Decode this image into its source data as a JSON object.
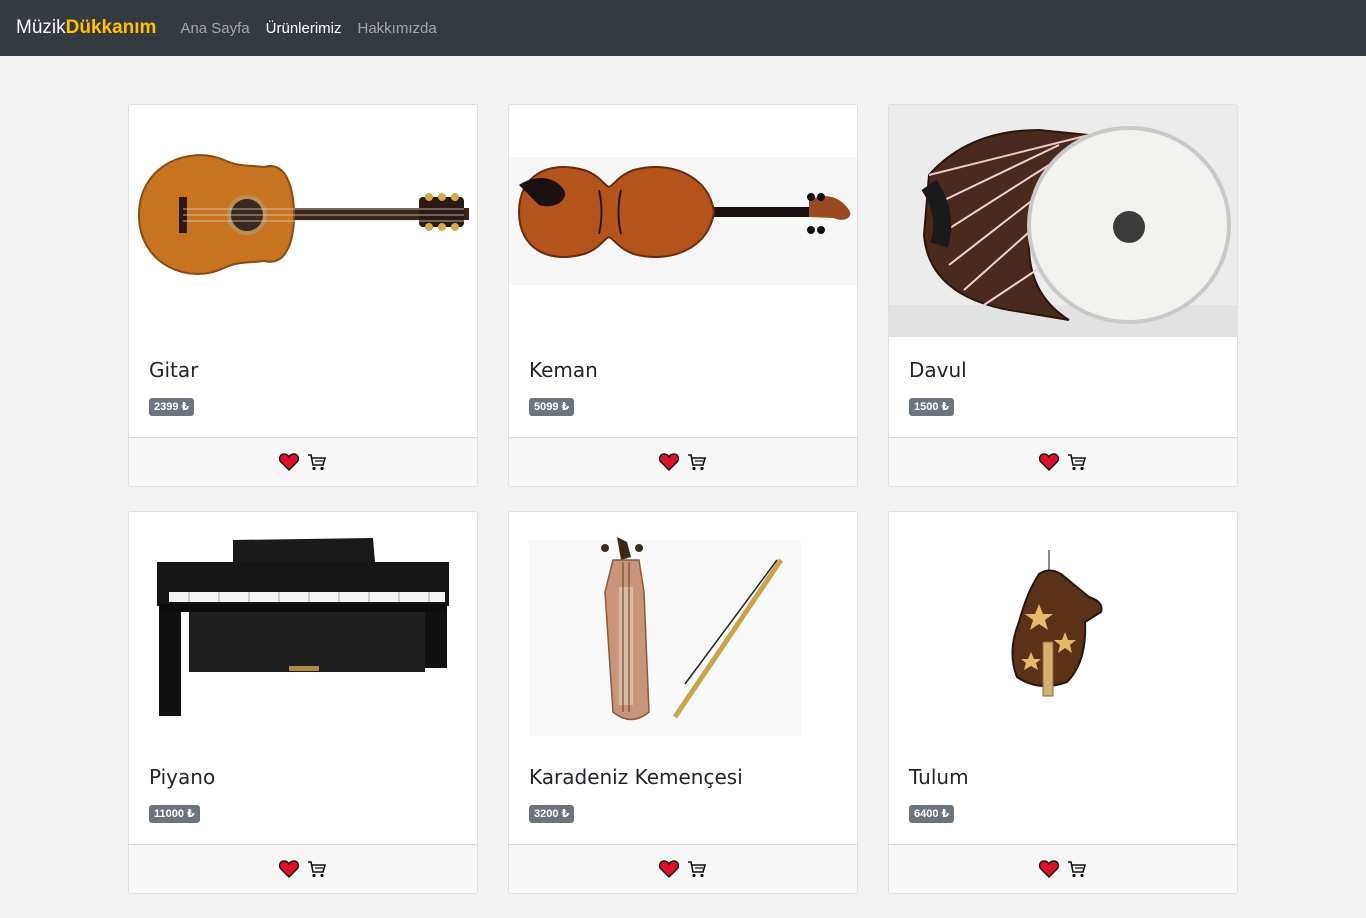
{
  "navbar": {
    "brand_prefix": "Müzik",
    "brand_accent": "Dükkanım",
    "links": [
      {
        "label": "Ana Sayfa",
        "active": false
      },
      {
        "label": "Ürünlerimiz",
        "active": true
      },
      {
        "label": "Hakkımızda",
        "active": false
      }
    ]
  },
  "colors": {
    "navbar_bg": "#343a40",
    "brand_accent": "#ffc107",
    "badge_bg": "#6c757d",
    "heart": "#e0102a",
    "page_bg": "#f2f2f2"
  },
  "products": [
    {
      "name": "Gitar",
      "price": "2399 ₺",
      "image_icon": "guitar-image"
    },
    {
      "name": "Keman",
      "price": "5099 ₺",
      "image_icon": "violin-image"
    },
    {
      "name": "Davul",
      "price": "1500 ₺",
      "image_icon": "drum-image"
    },
    {
      "name": "Piyano",
      "price": "11000 ₺",
      "image_icon": "piano-image"
    },
    {
      "name": "Karadeniz Kemençesi",
      "price": "3200 ₺",
      "image_icon": "kemence-image"
    },
    {
      "name": "Tulum",
      "price": "6400 ₺",
      "image_icon": "tulum-image"
    }
  ],
  "footer_icons": [
    "heart-icon",
    "cart-icon"
  ]
}
